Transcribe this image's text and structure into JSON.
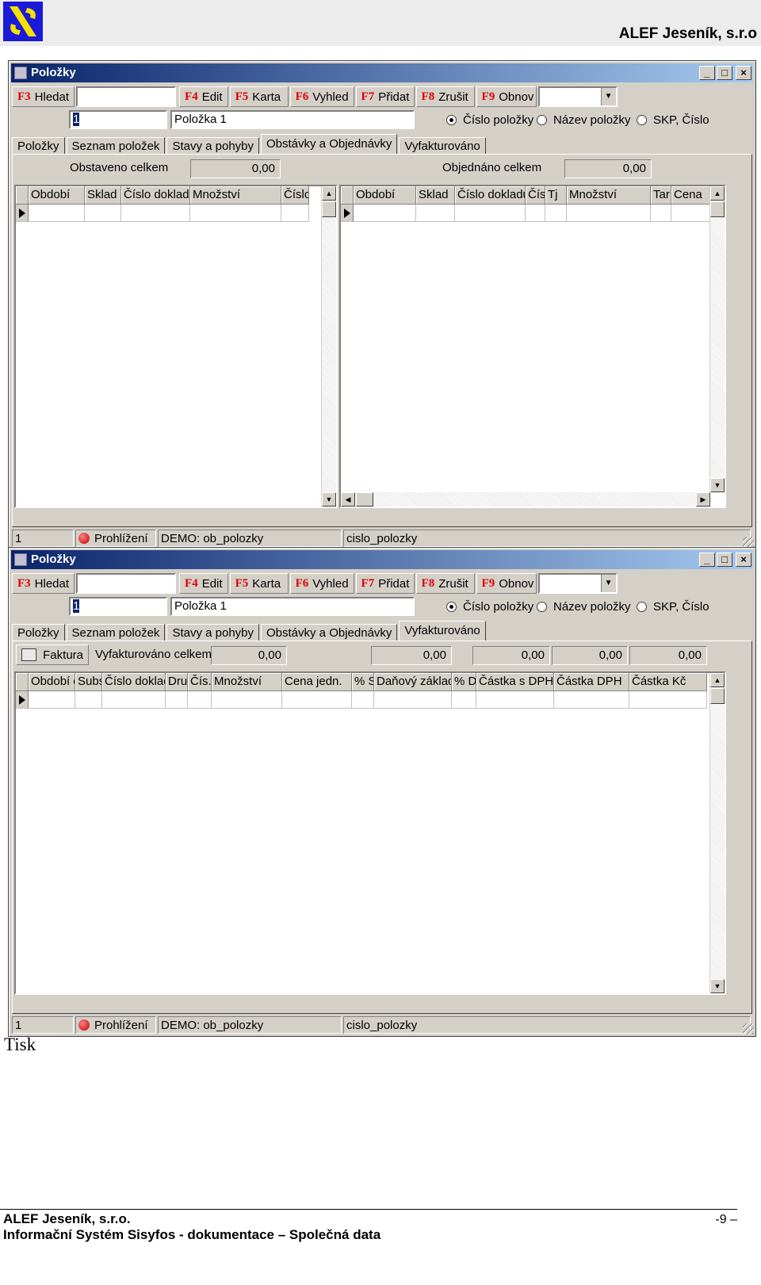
{
  "header": {
    "company": "ALEF Jeseník, s.r.o"
  },
  "window": {
    "title": "Položky",
    "fbuttons": [
      {
        "key": "F3",
        "label": "Hledat"
      },
      {
        "key": "F4",
        "label": "Edit"
      },
      {
        "key": "F5",
        "label": "Karta"
      },
      {
        "key": "F6",
        "label": "Vyhled"
      },
      {
        "key": "F7",
        "label": "Přidat"
      },
      {
        "key": "F8",
        "label": "Zrušit"
      },
      {
        "key": "F9",
        "label": "Obnov"
      }
    ],
    "search_value": "",
    "code_value": "1",
    "name_value": "Položka 1",
    "radios": [
      {
        "label": "Číslo položky",
        "selected": true
      },
      {
        "label": "Název položky",
        "selected": false
      },
      {
        "label": "SKP, Číslo",
        "selected": false
      }
    ],
    "tabs": [
      "Položky",
      "Seznam položek",
      "Stavy a pohyby",
      "Obstávky a Objednávky",
      "Vyfakturováno"
    ],
    "status": {
      "record": "1",
      "mode": "Prohlížení",
      "db": "DEMO: ob_polozky",
      "field": "cislo_polozky"
    }
  },
  "win1": {
    "active_tab": "Obstávky a Objednávky",
    "left_label": "Obstaveno celkem",
    "left_total": "0,00",
    "right_label": "Objednáno celkem",
    "right_total": "0,00",
    "left_columns": [
      "Období",
      "Sklad",
      "Číslo dokladu",
      "Množství",
      "Číslo"
    ],
    "right_columns": [
      "Období",
      "Sklad",
      "Číslo dokladu",
      "Čís",
      "Tj",
      "Množství",
      "Tar",
      "Cena"
    ]
  },
  "win2": {
    "active_tab": "Vyfakturováno",
    "invoice_button": "Faktura",
    "total_label": "Vyfakturováno celkem",
    "totals": [
      "0,00",
      "0,00",
      "0,00",
      "0,00",
      "0,00"
    ],
    "columns": [
      "Období d",
      "Subs",
      "Číslo doklad",
      "Dru",
      "Čís.",
      "Množství",
      "Cena jedn.",
      "% S",
      "Daňový základ",
      "% D",
      "Částka s DPH",
      "Částka DPH",
      "Částka Kč"
    ]
  },
  "section_title": "Tisk",
  "footer": {
    "company": "ALEF Jeseník, s.r.o.",
    "doc": "Informační Systém Sisyfos - dokumentace – Společná data",
    "page": "-9 –"
  }
}
